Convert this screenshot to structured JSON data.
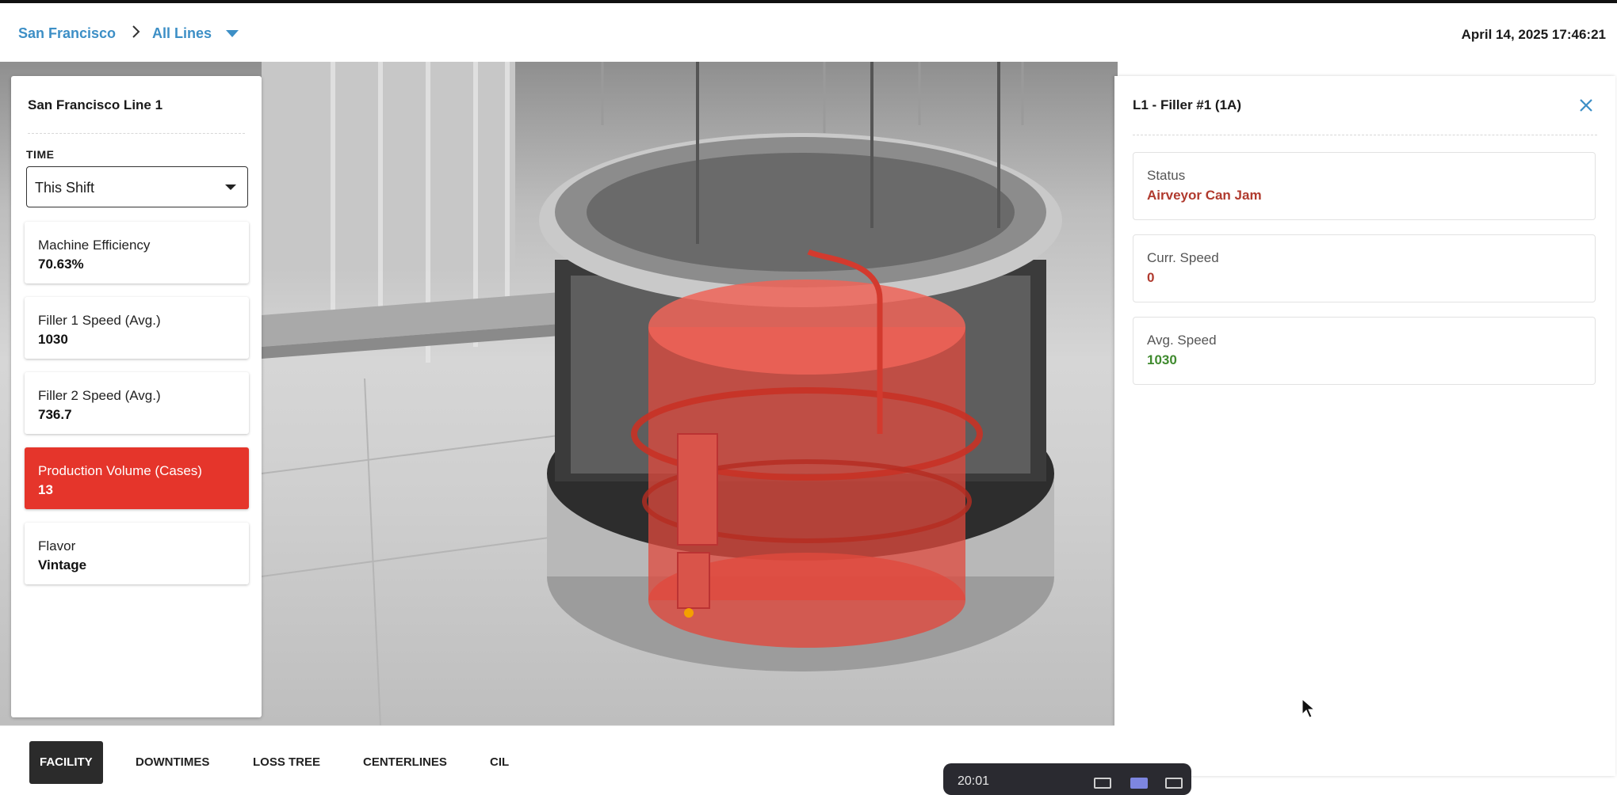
{
  "header": {
    "breadcrumb": {
      "site": "San Francisco",
      "lines": "All Lines"
    },
    "datetime": "April 14, 2025 17:46:21"
  },
  "left_panel": {
    "title": "San Francisco Line 1",
    "time_label": "TIME",
    "time_select": {
      "value": "This Shift"
    },
    "metrics": [
      {
        "label": "Machine Efficiency",
        "value": "70.63%"
      },
      {
        "label": "Filler 1 Speed (Avg.)",
        "value": "1030"
      },
      {
        "label": "Filler 2 Speed (Avg.)",
        "value": "736.7"
      },
      {
        "label": "Production Volume (Cases)",
        "value": "13"
      },
      {
        "label": "Flavor",
        "value": "Vintage"
      }
    ]
  },
  "right_panel": {
    "title": "L1 - Filler #1 (1A)",
    "cards": [
      {
        "label": "Status",
        "value": "Airveyor Can Jam"
      },
      {
        "label": "Curr. Speed",
        "value": "0"
      },
      {
        "label": "Avg. Speed",
        "value": "1030"
      }
    ]
  },
  "tabs": [
    "FACILITY",
    "DOWNTIMES",
    "LOSS TREE",
    "CENTERLINES",
    "CIL"
  ],
  "floating_bar": {
    "time": "20:01"
  },
  "colors": {
    "accent_blue": "#3d8fc6",
    "alert_red": "#e5352b",
    "status_red": "#b03a2e",
    "good_green": "#3f8a2e"
  },
  "icons": [
    "chevron-right-icon",
    "caret-down-icon",
    "close-icon",
    "mouse-pointer-icon"
  ]
}
